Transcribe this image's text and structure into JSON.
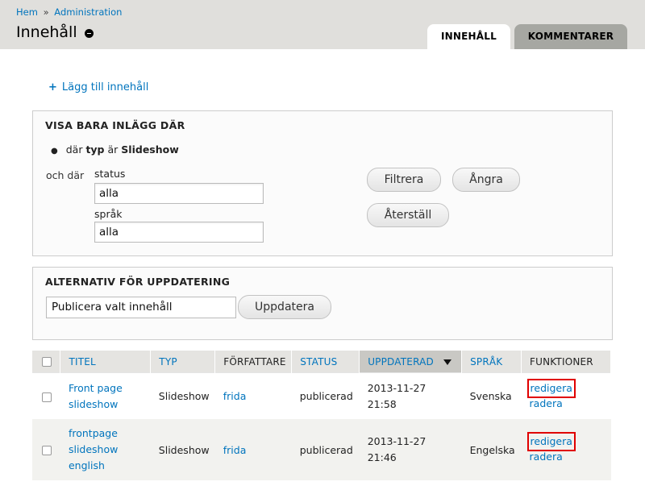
{
  "breadcrumb": {
    "home": "Hem",
    "sep": "»",
    "admin": "Administration"
  },
  "page_title": "Innehåll",
  "tabs": [
    {
      "label": "INNEHÅLL"
    },
    {
      "label": "KOMMENTARER"
    }
  ],
  "add_content": "Lägg till innehåll",
  "filter": {
    "legend": "VISA BARA INLÄGG DÄR",
    "criterion_prefix": "där",
    "criterion_field": "typ",
    "criterion_verb": "är",
    "criterion_value": "Slideshow",
    "and_where": "och där",
    "status_label": "status",
    "status_value": "alla",
    "language_label": "språk",
    "language_value": "alla",
    "filter_button": "Filtrera",
    "undo_button": "Ångra",
    "reset_button": "Återställ"
  },
  "update": {
    "legend": "ALTERNATIV FÖR UPPDATERING",
    "selected_option": "Publicera valt innehåll",
    "button": "Uppdatera"
  },
  "table": {
    "headers": [
      "TITEL",
      "TYP",
      "FÖRFATTARE",
      "STATUS",
      "UPPDATERAD",
      "SPRÅK",
      "FUNKTIONER"
    ],
    "rows": [
      {
        "title": [
          "Front page",
          "slideshow"
        ],
        "type": "Slideshow",
        "author": "frida",
        "status": "publicerad",
        "updated": [
          "2013-11-27",
          "21:58"
        ],
        "language": "Svenska",
        "edit": "redigera",
        "delete": "radera"
      },
      {
        "title": [
          "frontpage",
          "slideshow",
          "english"
        ],
        "type": "Slideshow",
        "author": "frida",
        "status": "publicerad",
        "updated": [
          "2013-11-27",
          "21:46"
        ],
        "language": "Engelska",
        "edit": "redigera",
        "delete": "radera"
      }
    ]
  },
  "colors": {
    "link": "#0074bd",
    "header_bg": "#e0dfdc",
    "highlight": "#e00000"
  }
}
